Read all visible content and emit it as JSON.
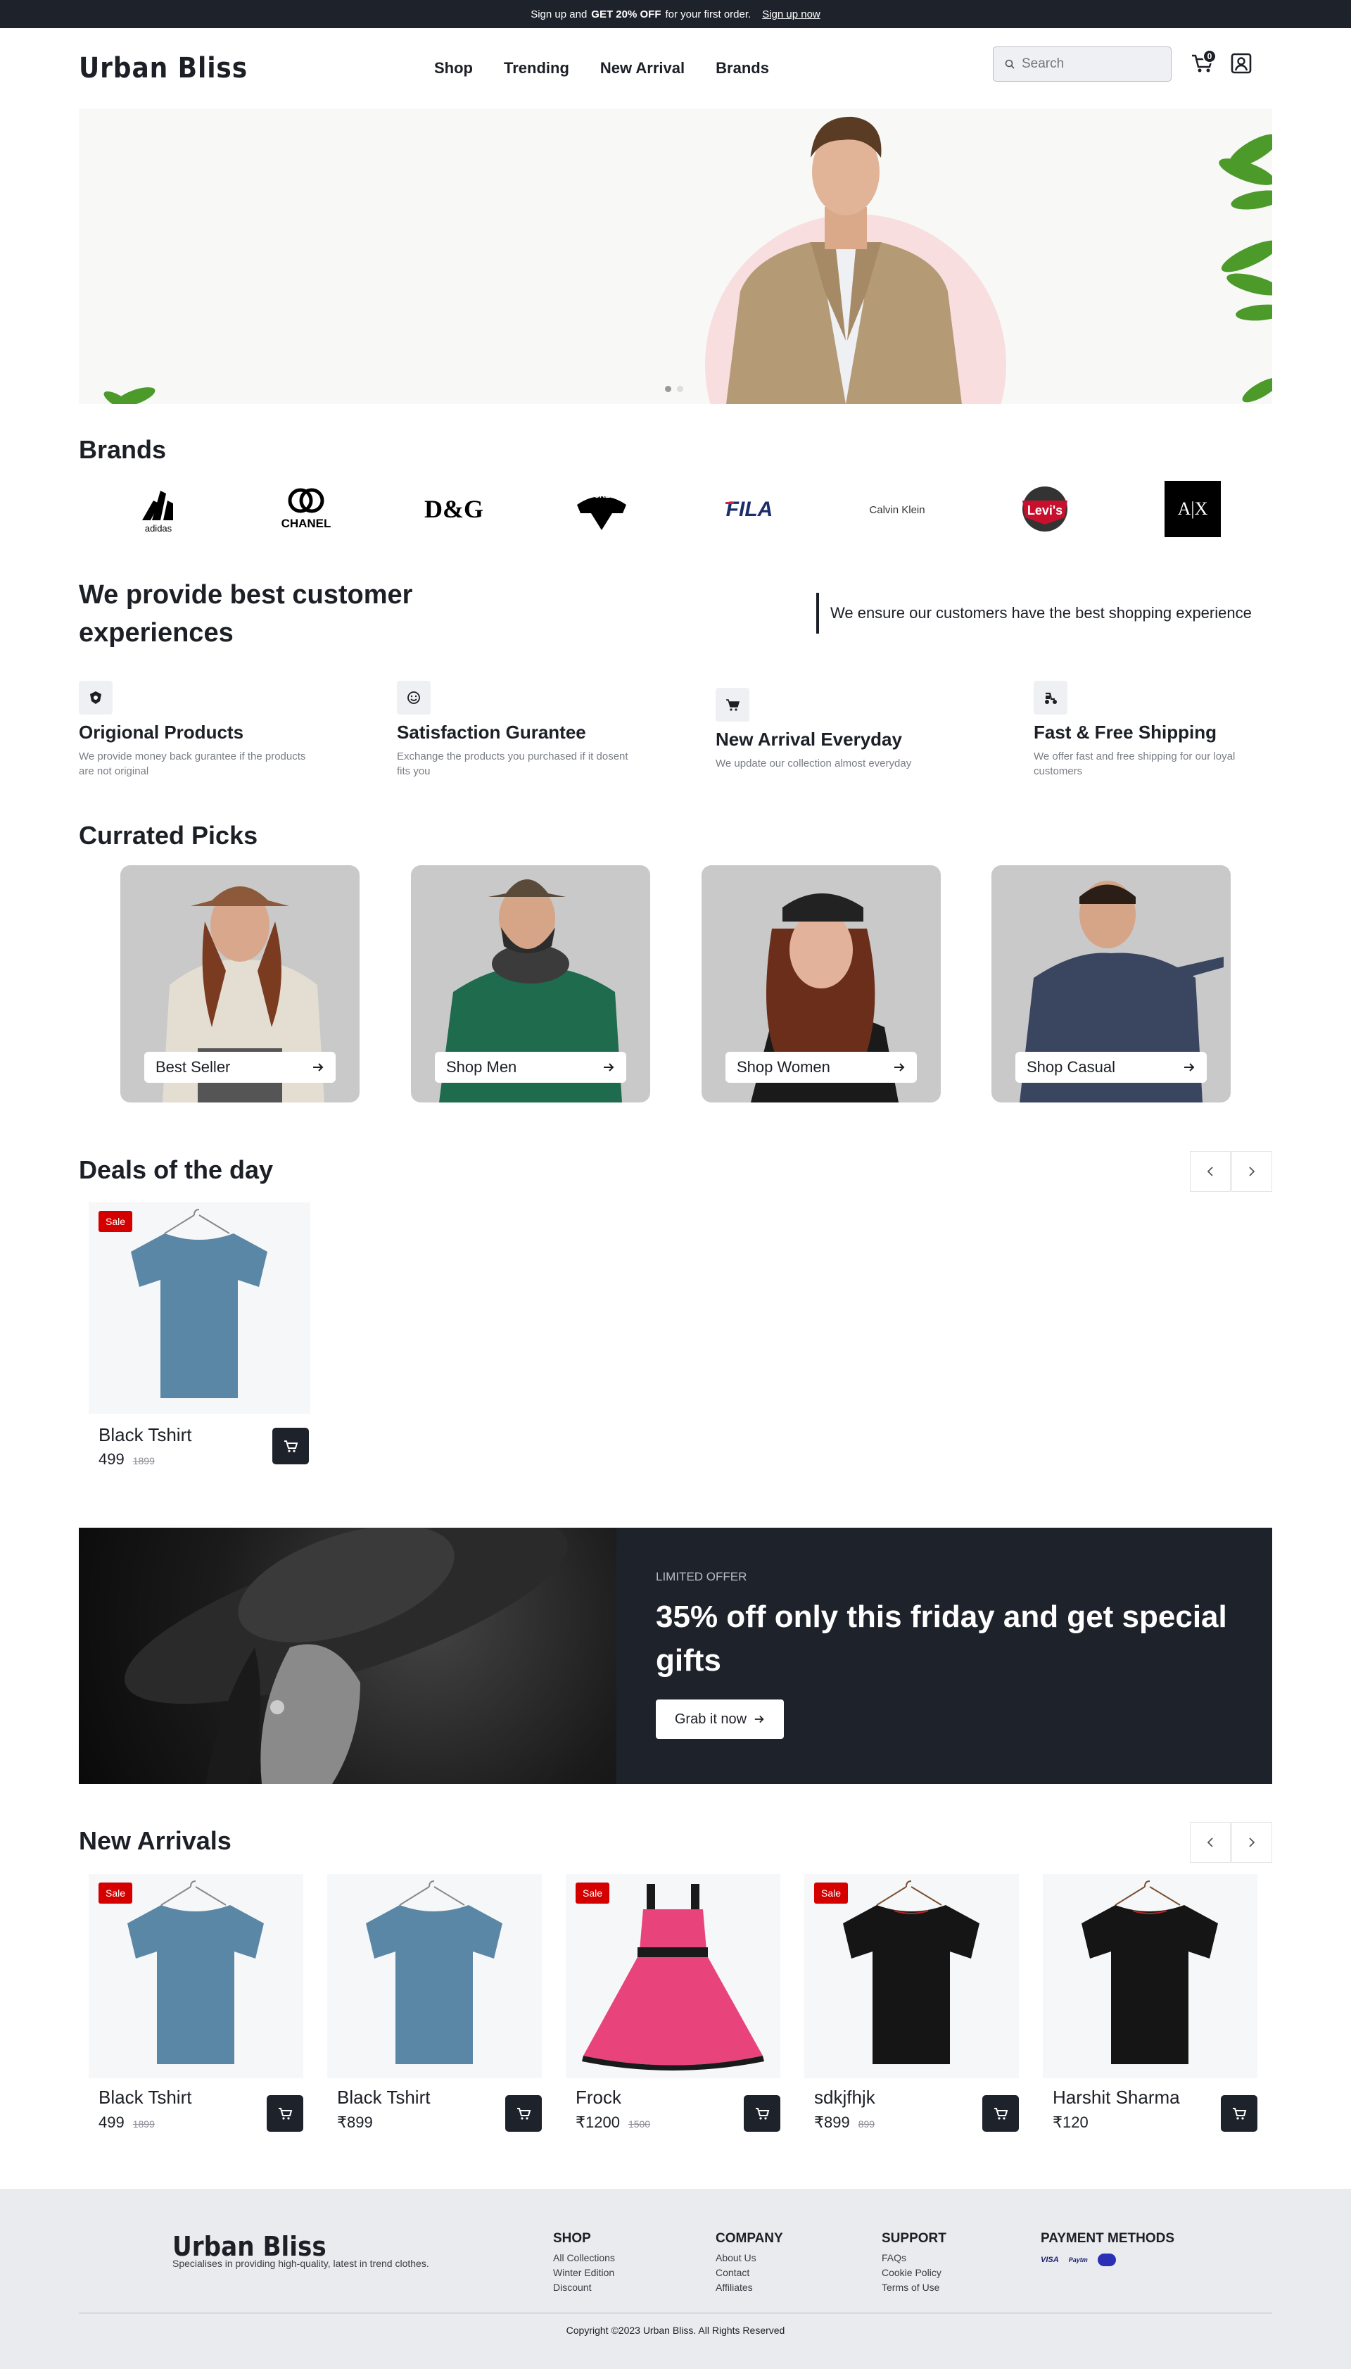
{
  "topbar": {
    "prefix": "Sign up and",
    "highlight": "GET 20% OFF",
    "suffix": "for your first order.",
    "link": "Sign up now"
  },
  "header": {
    "logo": "Urban Bliss",
    "nav": [
      "Shop",
      "Trending",
      "New Arrival",
      "Brands"
    ],
    "search_placeholder": "Search",
    "cart_count": "0"
  },
  "hero": {
    "slides": 2,
    "active_slide": 0
  },
  "brands": {
    "title": "Brands",
    "items": [
      "adidas",
      "CHANEL",
      "D&G",
      "DOCKERS",
      "FILA",
      "Calvin Klein",
      "Levi's",
      "A|X"
    ]
  },
  "experience": {
    "heading": "We provide best customer experiences",
    "side_text": "We ensure our customers have the best shopping experience",
    "features": [
      {
        "title": "Origional Products",
        "desc": "We provide money back gurantee if the products are not original",
        "icon": "shield-icon"
      },
      {
        "title": "Satisfaction Gurantee",
        "desc": "Exchange the products you purchased if it dosent fits you",
        "icon": "smile-icon"
      },
      {
        "title": "New Arrival Everyday",
        "desc": "We update our collection almost everyday",
        "icon": "cart-icon"
      },
      {
        "title": "Fast & Free Shipping",
        "desc": "We offer fast and free shipping for our loyal customers",
        "icon": "scooter-icon"
      }
    ]
  },
  "curated": {
    "title": "Currated Picks",
    "picks": [
      {
        "label": "Best Seller"
      },
      {
        "label": "Shop Men"
      },
      {
        "label": "Shop Women"
      },
      {
        "label": "Shop Casual"
      }
    ]
  },
  "deals": {
    "title": "Deals of the day",
    "products": [
      {
        "name": "Black Tshirt",
        "price": "499",
        "old_price": "1899",
        "badge": "Sale",
        "color": "blue-shirt"
      }
    ]
  },
  "offer": {
    "kicker": "LIMITED OFFER",
    "title": "35% off only this friday and get special gifts",
    "button": "Grab it now"
  },
  "arrivals": {
    "title": "New Arrivals",
    "products": [
      {
        "name": "Black Tshirt",
        "price": "499",
        "old_price": "1899",
        "badge": "Sale",
        "color": "blue-shirt"
      },
      {
        "name": "Black Tshirt",
        "price": "₹899",
        "old_price": "",
        "badge": "",
        "color": "blue-shirt"
      },
      {
        "name": "Frock",
        "price": "₹1200",
        "old_price": "1500",
        "badge": "Sale",
        "color": "pink-dress"
      },
      {
        "name": "sdkjfhjk",
        "price": "₹899",
        "old_price": "899",
        "badge": "Sale",
        "color": "black-shirt"
      },
      {
        "name": "Harshit Sharma",
        "price": "₹120",
        "old_price": "",
        "badge": "",
        "color": "black-shirt"
      }
    ]
  },
  "footer": {
    "logo": "Urban Bliss",
    "tagline": "Specialises in providing high-quality, latest in trend clothes.",
    "columns": [
      {
        "head": "SHOP",
        "links": [
          "All Collections",
          "Winter Edition",
          "Discount"
        ]
      },
      {
        "head": "COMPANY",
        "links": [
          "About Us",
          "Contact",
          "Affiliates"
        ]
      },
      {
        "head": "SUPPORT",
        "links": [
          "FAQs",
          "Cookie Policy",
          "Terms of Use"
        ]
      }
    ],
    "payment_head": "PAYMENT METHODS",
    "payment_methods": [
      "VISA",
      "Paytm",
      "PhonePe"
    ],
    "copyright": "Copyright ©2023 Urban Bliss. All Rights Reserved"
  },
  "colors": {
    "dark": "#1e222b",
    "sale": "#d40000",
    "hero_bg": "#f8f8f7",
    "hero_circle": "#f8dede",
    "footer_bg": "#e9ebef"
  }
}
